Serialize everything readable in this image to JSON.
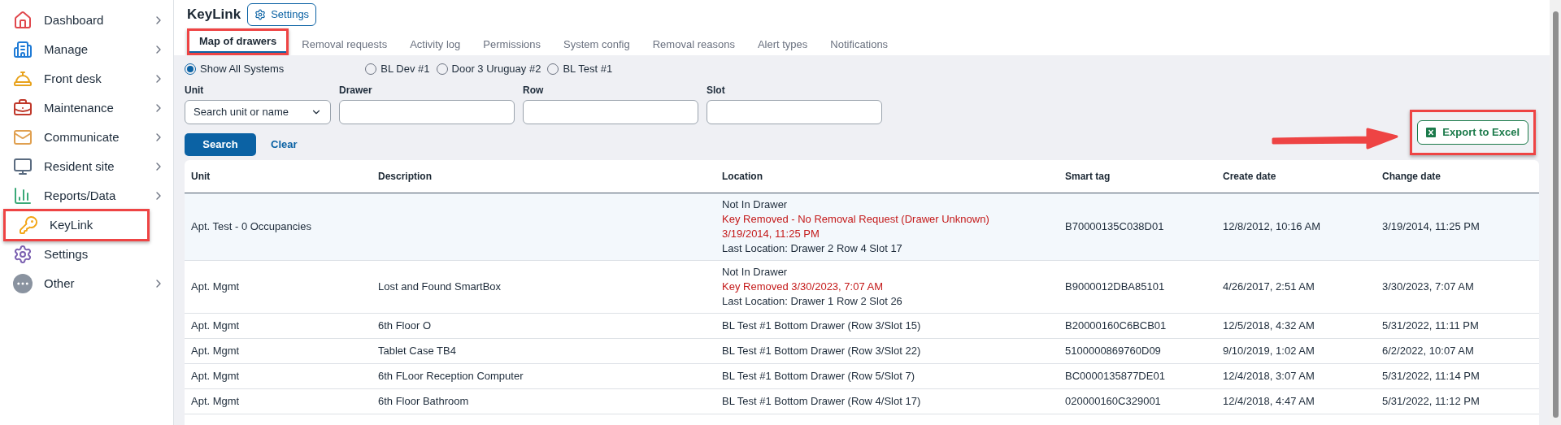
{
  "sidebar": {
    "items": [
      {
        "label": "Dashboard",
        "has_submenu": true,
        "callout": false
      },
      {
        "label": "Manage",
        "has_submenu": true,
        "callout": false
      },
      {
        "label": "Front desk",
        "has_submenu": true,
        "callout": false
      },
      {
        "label": "Maintenance",
        "has_submenu": true,
        "callout": false
      },
      {
        "label": "Communicate",
        "has_submenu": true,
        "callout": false
      },
      {
        "label": "Resident site",
        "has_submenu": true,
        "callout": false
      },
      {
        "label": "Reports/Data",
        "has_submenu": true,
        "callout": false
      },
      {
        "label": "KeyLink",
        "has_submenu": false,
        "callout": true
      },
      {
        "label": "Settings",
        "has_submenu": false,
        "callout": false
      },
      {
        "label": "Other",
        "has_submenu": true,
        "callout": false
      }
    ]
  },
  "header": {
    "title": "KeyLink",
    "settings_button": "Settings"
  },
  "tabs": [
    {
      "label": "Map of drawers",
      "selected": true,
      "callout": true
    },
    {
      "label": "Removal requests",
      "selected": false,
      "callout": false
    },
    {
      "label": "Activity log",
      "selected": false,
      "callout": false
    },
    {
      "label": "Permissions",
      "selected": false,
      "callout": false
    },
    {
      "label": "System config",
      "selected": false,
      "callout": false
    },
    {
      "label": "Removal reasons",
      "selected": false,
      "callout": false
    },
    {
      "label": "Alert types",
      "selected": false,
      "callout": false
    },
    {
      "label": "Notifications",
      "selected": false,
      "callout": false
    }
  ],
  "systems": [
    {
      "label": "Show All Systems",
      "selected": true
    },
    {
      "label": "BL Dev #1",
      "selected": false
    },
    {
      "label": "Door 3 Uruguay #2",
      "selected": false
    },
    {
      "label": "BL Test #1",
      "selected": false
    }
  ],
  "filters": [
    {
      "kind": "select",
      "label": "Unit",
      "placeholder": "Search unit or name"
    },
    {
      "kind": "text",
      "label": "Drawer"
    },
    {
      "kind": "text",
      "label": "Row"
    },
    {
      "kind": "text",
      "label": "Slot"
    }
  ],
  "actions": {
    "search": "Search",
    "clear": "Clear"
  },
  "export": {
    "label": "Export to Excel",
    "callout": true
  },
  "table": {
    "columns": [
      "Unit",
      "Description",
      "Location",
      "Smart tag",
      "Create date",
      "Change date"
    ],
    "rows": [
      {
        "selected": true,
        "unit": "Apt. Test - 0 Occupancies",
        "description": "",
        "location": [
          {
            "kind": "status",
            "text": "Not In Drawer"
          },
          {
            "kind": "alert",
            "text": "Key Removed - No Removal Request (Drawer Unknown) 3/19/2014, 11:25 PM"
          },
          {
            "kind": "status",
            "text": "Last Location: Drawer 2 Row 4 Slot 17"
          }
        ],
        "smart_tag": "B70000135C038D01",
        "create_date": "12/8/2012, 10:16 AM",
        "change_date": "3/19/2014, 11:25 PM"
      },
      {
        "selected": false,
        "unit": "Apt. Mgmt",
        "description": "Lost and Found SmartBox",
        "location": [
          {
            "kind": "status",
            "text": "Not In Drawer"
          },
          {
            "kind": "alert",
            "text": "Key Removed 3/30/2023, 7:07 AM"
          },
          {
            "kind": "status",
            "text": "Last Location: Drawer 1 Row 2 Slot 26"
          }
        ],
        "smart_tag": "B9000012DBA85101",
        "create_date": "4/26/2017, 2:51 AM",
        "change_date": "3/30/2023, 7:07 AM"
      },
      {
        "selected": false,
        "unit": "Apt. Mgmt",
        "description": "6th Floor O",
        "location": [
          {
            "kind": "status",
            "text": "BL Test #1 Bottom Drawer (Row 3/Slot 15)"
          }
        ],
        "smart_tag": "B20000160C6BCB01",
        "create_date": "12/5/2018, 4:32 AM",
        "change_date": "5/31/2022, 11:11 PM"
      },
      {
        "selected": false,
        "unit": "Apt. Mgmt",
        "description": "Tablet Case TB4",
        "location": [
          {
            "kind": "status",
            "text": "BL Test #1 Bottom Drawer (Row 3/Slot 22)"
          }
        ],
        "smart_tag": "5100000869760D09",
        "create_date": "9/10/2019, 1:02 AM",
        "change_date": "6/2/2022, 10:07 AM"
      },
      {
        "selected": false,
        "unit": "Apt. Mgmt",
        "description": "6th FLoor Reception Computer",
        "location": [
          {
            "kind": "status",
            "text": "BL Test #1 Bottom Drawer (Row 5/Slot 7)"
          }
        ],
        "smart_tag": "BC0000135877DE01",
        "create_date": "12/4/2018, 3:07 AM",
        "change_date": "5/31/2022, 11:14 PM"
      },
      {
        "selected": false,
        "unit": "Apt. Mgmt",
        "description": "6th Floor Bathroom",
        "location": [
          {
            "kind": "status",
            "text": "BL Test #1 Bottom Drawer (Row 4/Slot 17)"
          }
        ],
        "smart_tag": "020000160C329001",
        "create_date": "12/4/2018, 4:47 AM",
        "change_date": "5/31/2022, 11:12 PM"
      }
    ]
  }
}
